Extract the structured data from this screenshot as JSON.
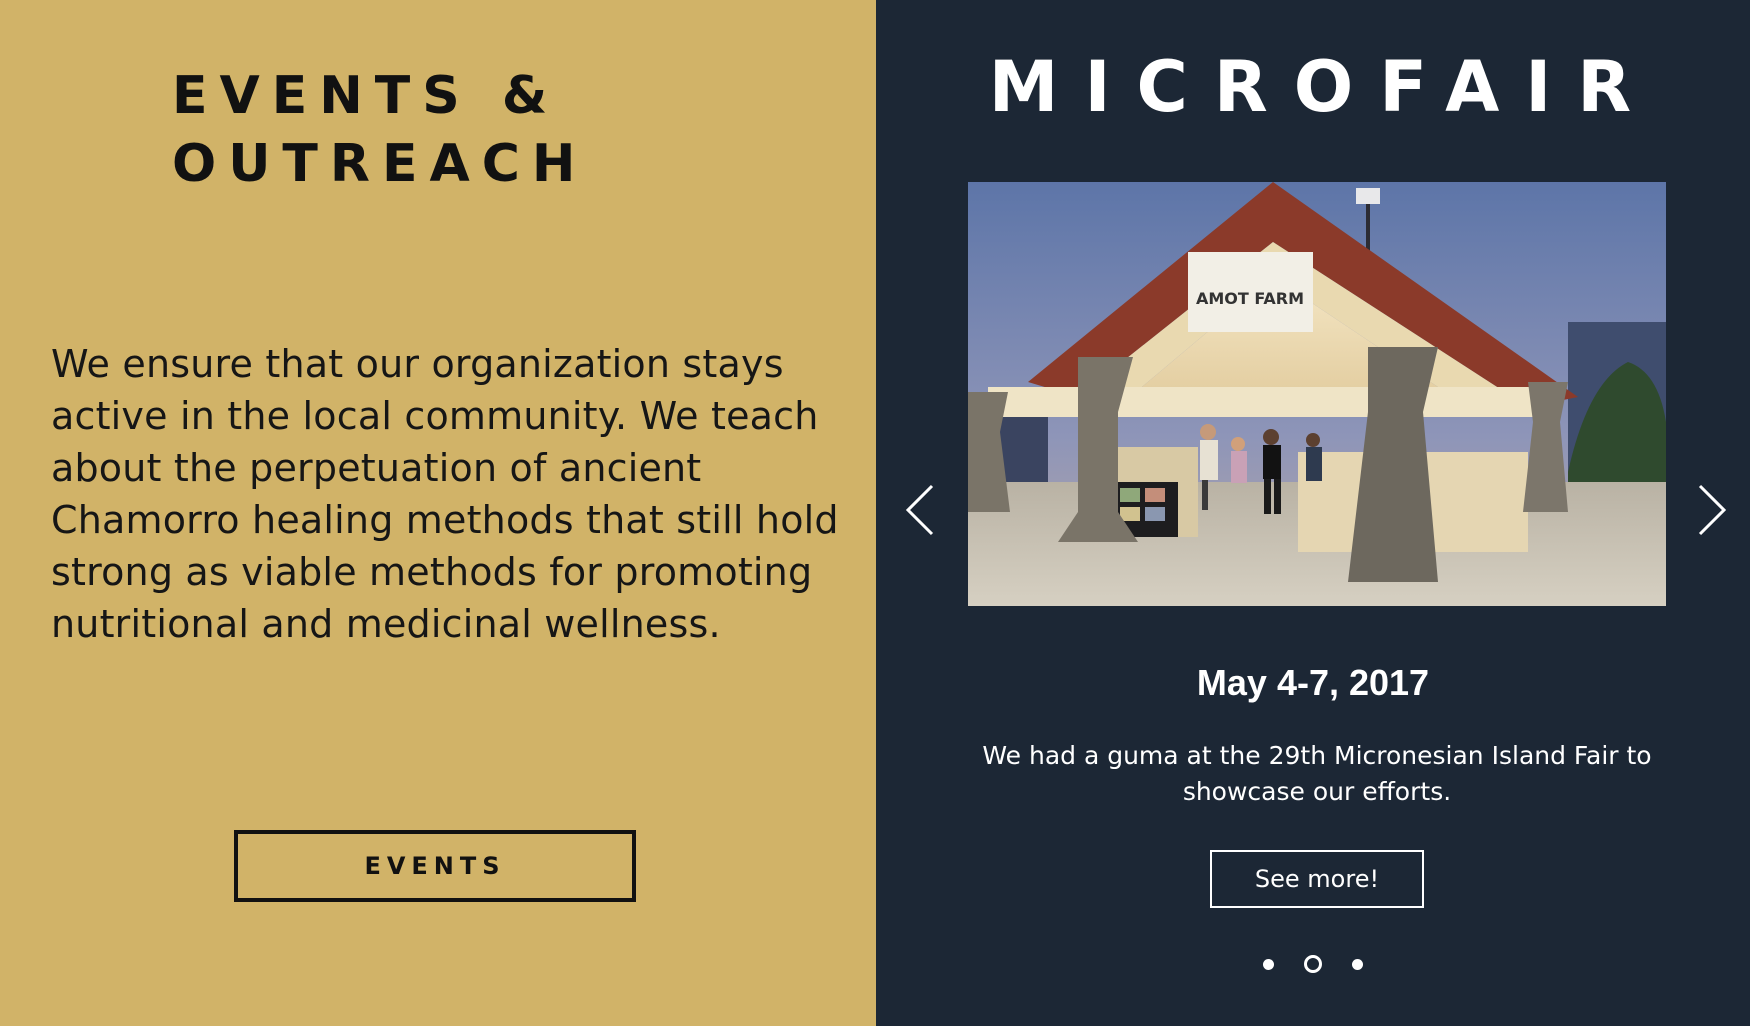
{
  "left": {
    "title_line1": "EVENTS &",
    "title_line2": "OUTREACH",
    "body": "We ensure that our organization stays active in the local community. We teach about the perpetuation of ancient Chamorro healing methods that still hold strong as viable methods for promoting nutritional and medicinal wellness.",
    "button_label": "EVENTS"
  },
  "right": {
    "title": "MICROFAIR",
    "slide": {
      "sign_text": "AMOT FARM",
      "date": "May 4-7, 2017",
      "description": "We had a guma at the 29th Micronesian Island Fair to showcase our efforts.",
      "button_label": "See more!"
    },
    "pagination": {
      "total": 3,
      "active_index": 1
    }
  },
  "colors": {
    "left_background": "#d1b368",
    "right_background": "#1c2735",
    "text_dark": "#111111",
    "text_light": "#ffffff"
  },
  "icons": {
    "prev": "chevron-left-icon",
    "next": "chevron-right-icon"
  }
}
